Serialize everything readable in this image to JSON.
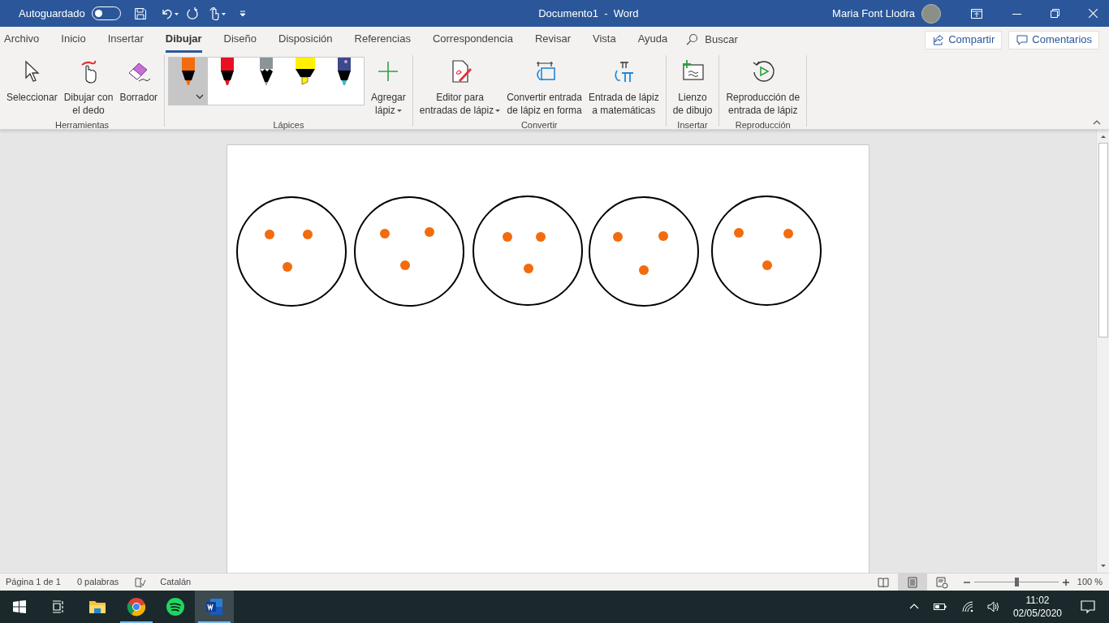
{
  "title_bar": {
    "autosave_label": "Autoguardado",
    "autosave_on": false,
    "title": "Documento1  -  Word",
    "user": "Maria Font Llodra"
  },
  "tabs": [
    {
      "label": "Archivo",
      "selected": false
    },
    {
      "label": "Inicio",
      "selected": false
    },
    {
      "label": "Insertar",
      "selected": false
    },
    {
      "label": "Dibujar",
      "selected": true
    },
    {
      "label": "Diseño",
      "selected": false
    },
    {
      "label": "Disposición",
      "selected": false
    },
    {
      "label": "Referencias",
      "selected": false
    },
    {
      "label": "Correspondencia",
      "selected": false
    },
    {
      "label": "Revisar",
      "selected": false
    },
    {
      "label": "Vista",
      "selected": false
    },
    {
      "label": "Ayuda",
      "selected": false
    }
  ],
  "search": {
    "placeholder": "Buscar"
  },
  "share_button": "Compartir",
  "comments_button": "Comentarios",
  "ribbon": {
    "groups": [
      {
        "label": "Herramientas",
        "buttons": [
          {
            "kind": "select",
            "lines": [
              "Seleccionar"
            ],
            "dropdown": false
          },
          {
            "kind": "finger",
            "lines": [
              "Dibujar con",
              "el dedo"
            ],
            "dropdown": false
          },
          {
            "kind": "eraser",
            "lines": [
              "Borrador"
            ],
            "dropdown": false
          }
        ]
      },
      {
        "label": "Lápices",
        "pens": [
          {
            "kind": "pen",
            "color": "#f26b0e",
            "selected": true
          },
          {
            "kind": "pen",
            "color": "#e81123",
            "selected": false
          },
          {
            "kind": "pencil",
            "color": "#8a9499",
            "selected": false
          },
          {
            "kind": "highlighter",
            "color": "#fff100",
            "selected": false
          },
          {
            "kind": "galaxy",
            "color": "#3a4a8a",
            "selected": false
          }
        ],
        "buttons": [
          {
            "kind": "add",
            "lines": [
              "Agregar",
              "lápiz"
            ],
            "dropdown": true
          }
        ]
      },
      {
        "label": "Convertir",
        "buttons": [
          {
            "kind": "editor",
            "lines": [
              "Editor para",
              "entradas de lápiz"
            ],
            "dropdown": true
          },
          {
            "kind": "shape",
            "lines": [
              "Convertir entrada",
              "de lápiz en forma"
            ],
            "dropdown": false
          },
          {
            "kind": "math",
            "lines": [
              "Entrada de lápiz",
              "a matemáticas"
            ],
            "dropdown": false
          }
        ]
      },
      {
        "label": "Insertar",
        "buttons": [
          {
            "kind": "canvas",
            "lines": [
              "Lienzo",
              "de dibujo"
            ],
            "dropdown": false
          }
        ]
      },
      {
        "label": "Reproducción",
        "buttons": [
          {
            "kind": "replay",
            "lines": [
              "Reproducción de",
              "entrada de lápiz"
            ],
            "dropdown": false
          }
        ]
      }
    ]
  },
  "status_bar": {
    "page": "Página 1 de 1",
    "words": "0 palabras",
    "language": "Catalán",
    "views": [
      {
        "kind": "read",
        "selected": false
      },
      {
        "kind": "print",
        "selected": true
      },
      {
        "kind": "web",
        "selected": false
      }
    ],
    "zoom": {
      "level": 0.5,
      "reading": "100 %"
    }
  },
  "taskbar": {
    "apps": [
      {
        "kind": "explorer",
        "selected": false
      },
      {
        "kind": "chrome",
        "selected": false
      },
      {
        "kind": "spotify",
        "selected": false
      },
      {
        "kind": "word",
        "selected": true
      }
    ],
    "time": "11:02",
    "date": "02/05/2020"
  }
}
